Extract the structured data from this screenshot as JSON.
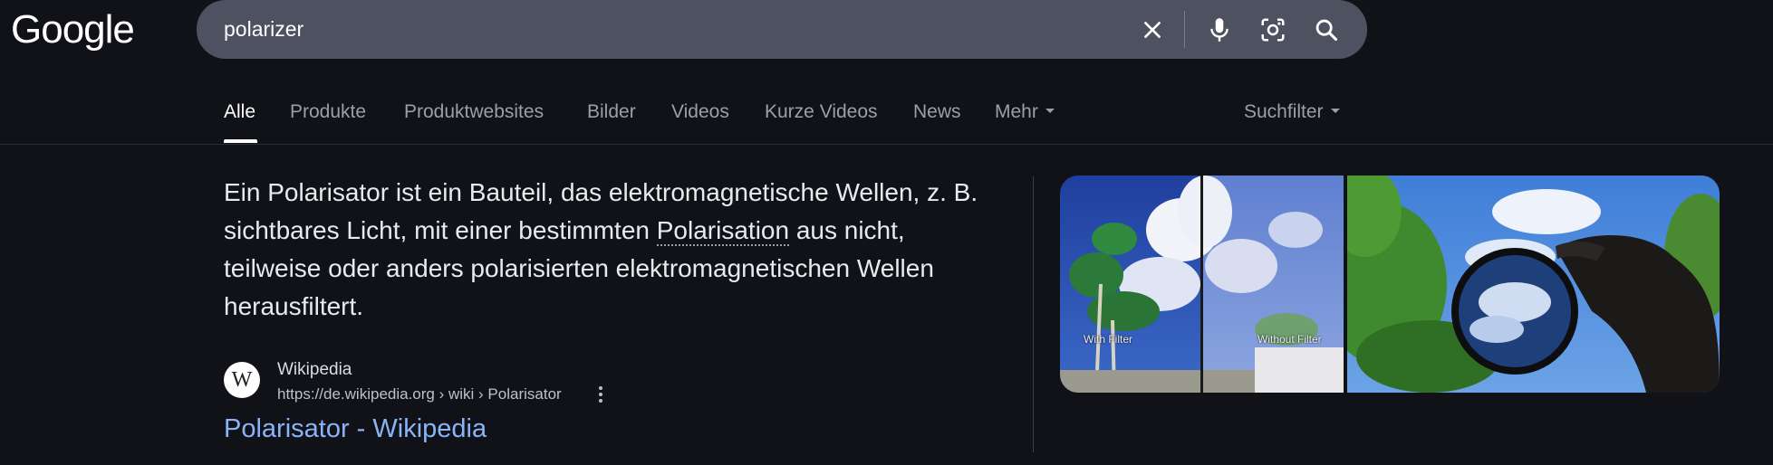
{
  "logo": {
    "text": "Google"
  },
  "search": {
    "query": "polarizer",
    "clear_icon": "close-icon",
    "voice_icon": "microphone-icon",
    "lens_icon": "camera-lens-icon",
    "search_icon": "search-icon"
  },
  "tabs": [
    {
      "label": "Alle",
      "active": true
    },
    {
      "label": "Produkte"
    },
    {
      "label": "Produktwebsites"
    },
    {
      "label": "Bilder"
    },
    {
      "label": "Videos"
    },
    {
      "label": "Kurze Videos"
    },
    {
      "label": "News"
    },
    {
      "label": "Mehr"
    }
  ],
  "filter": {
    "label": "Suchfilter"
  },
  "snippet": {
    "part1": "Ein Polarisator ist ein Bauteil, das elektromagnetische Wellen, z. B. sichtbares Licht, mit einer bestimmten ",
    "link": "Polarisation",
    "part2": " aus nicht, teilweise oder anders polarisierten elektromagnetischen Wellen herausfiltert."
  },
  "source": {
    "logo_letter": "W",
    "name": "Wikipedia",
    "url": "https://de.wikipedia.org › wiki › Polarisator"
  },
  "result": {
    "title": "Polarisator - Wikipedia"
  },
  "image": {
    "label_with": "With Filter",
    "label_without": "Without Filter"
  },
  "colors": {
    "background": "#101218",
    "searchbar": "#4d5160",
    "link": "#8ab4f8",
    "text": "#e8eaed",
    "muted": "#9aa0a6"
  }
}
